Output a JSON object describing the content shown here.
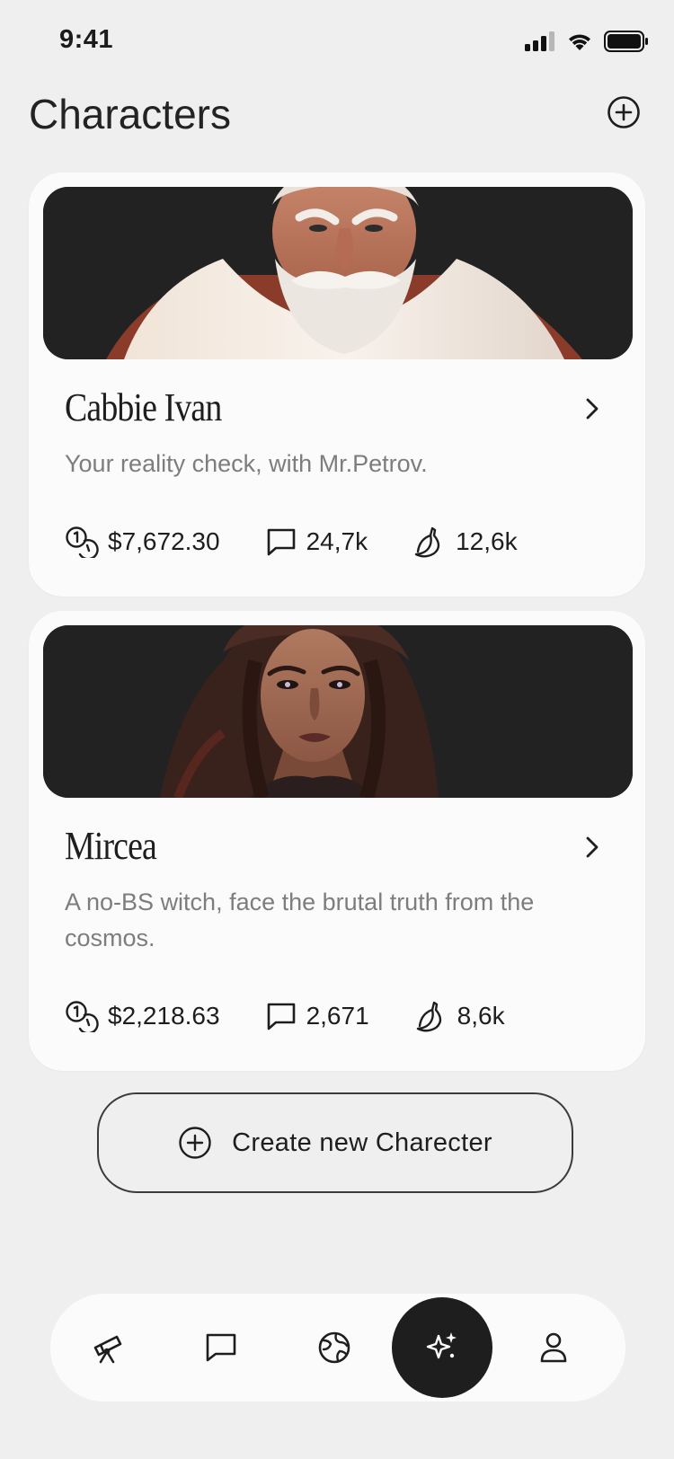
{
  "status_bar": {
    "time": "9:41"
  },
  "header": {
    "title": "Characters"
  },
  "characters": [
    {
      "name": "Cabbie Ivan",
      "description": "Your reality check, with Mr.Petrov.",
      "earnings": "$7,672.30",
      "messages": "24,7k",
      "bananas": "12,6k"
    },
    {
      "name": "Mircea",
      "description": "A no-BS witch, face the brutal truth from the cosmos.",
      "earnings": "$2,218.63",
      "messages": "2,671",
      "bananas": "8,6k"
    }
  ],
  "create_button": {
    "label": "Create new Charecter"
  },
  "bottom_nav": {
    "items": [
      {
        "icon": "telescope-icon",
        "active": false
      },
      {
        "icon": "chat-icon",
        "active": false
      },
      {
        "icon": "globe-icon",
        "active": false
      },
      {
        "icon": "sparkles-icon",
        "active": true
      },
      {
        "icon": "user-icon",
        "active": false
      }
    ]
  },
  "colors": {
    "background": "#efefef",
    "card": "#fbfbfb",
    "image_bg": "#222222",
    "nav_active": "#1e1e1e",
    "muted_text": "#7d7d7d"
  }
}
